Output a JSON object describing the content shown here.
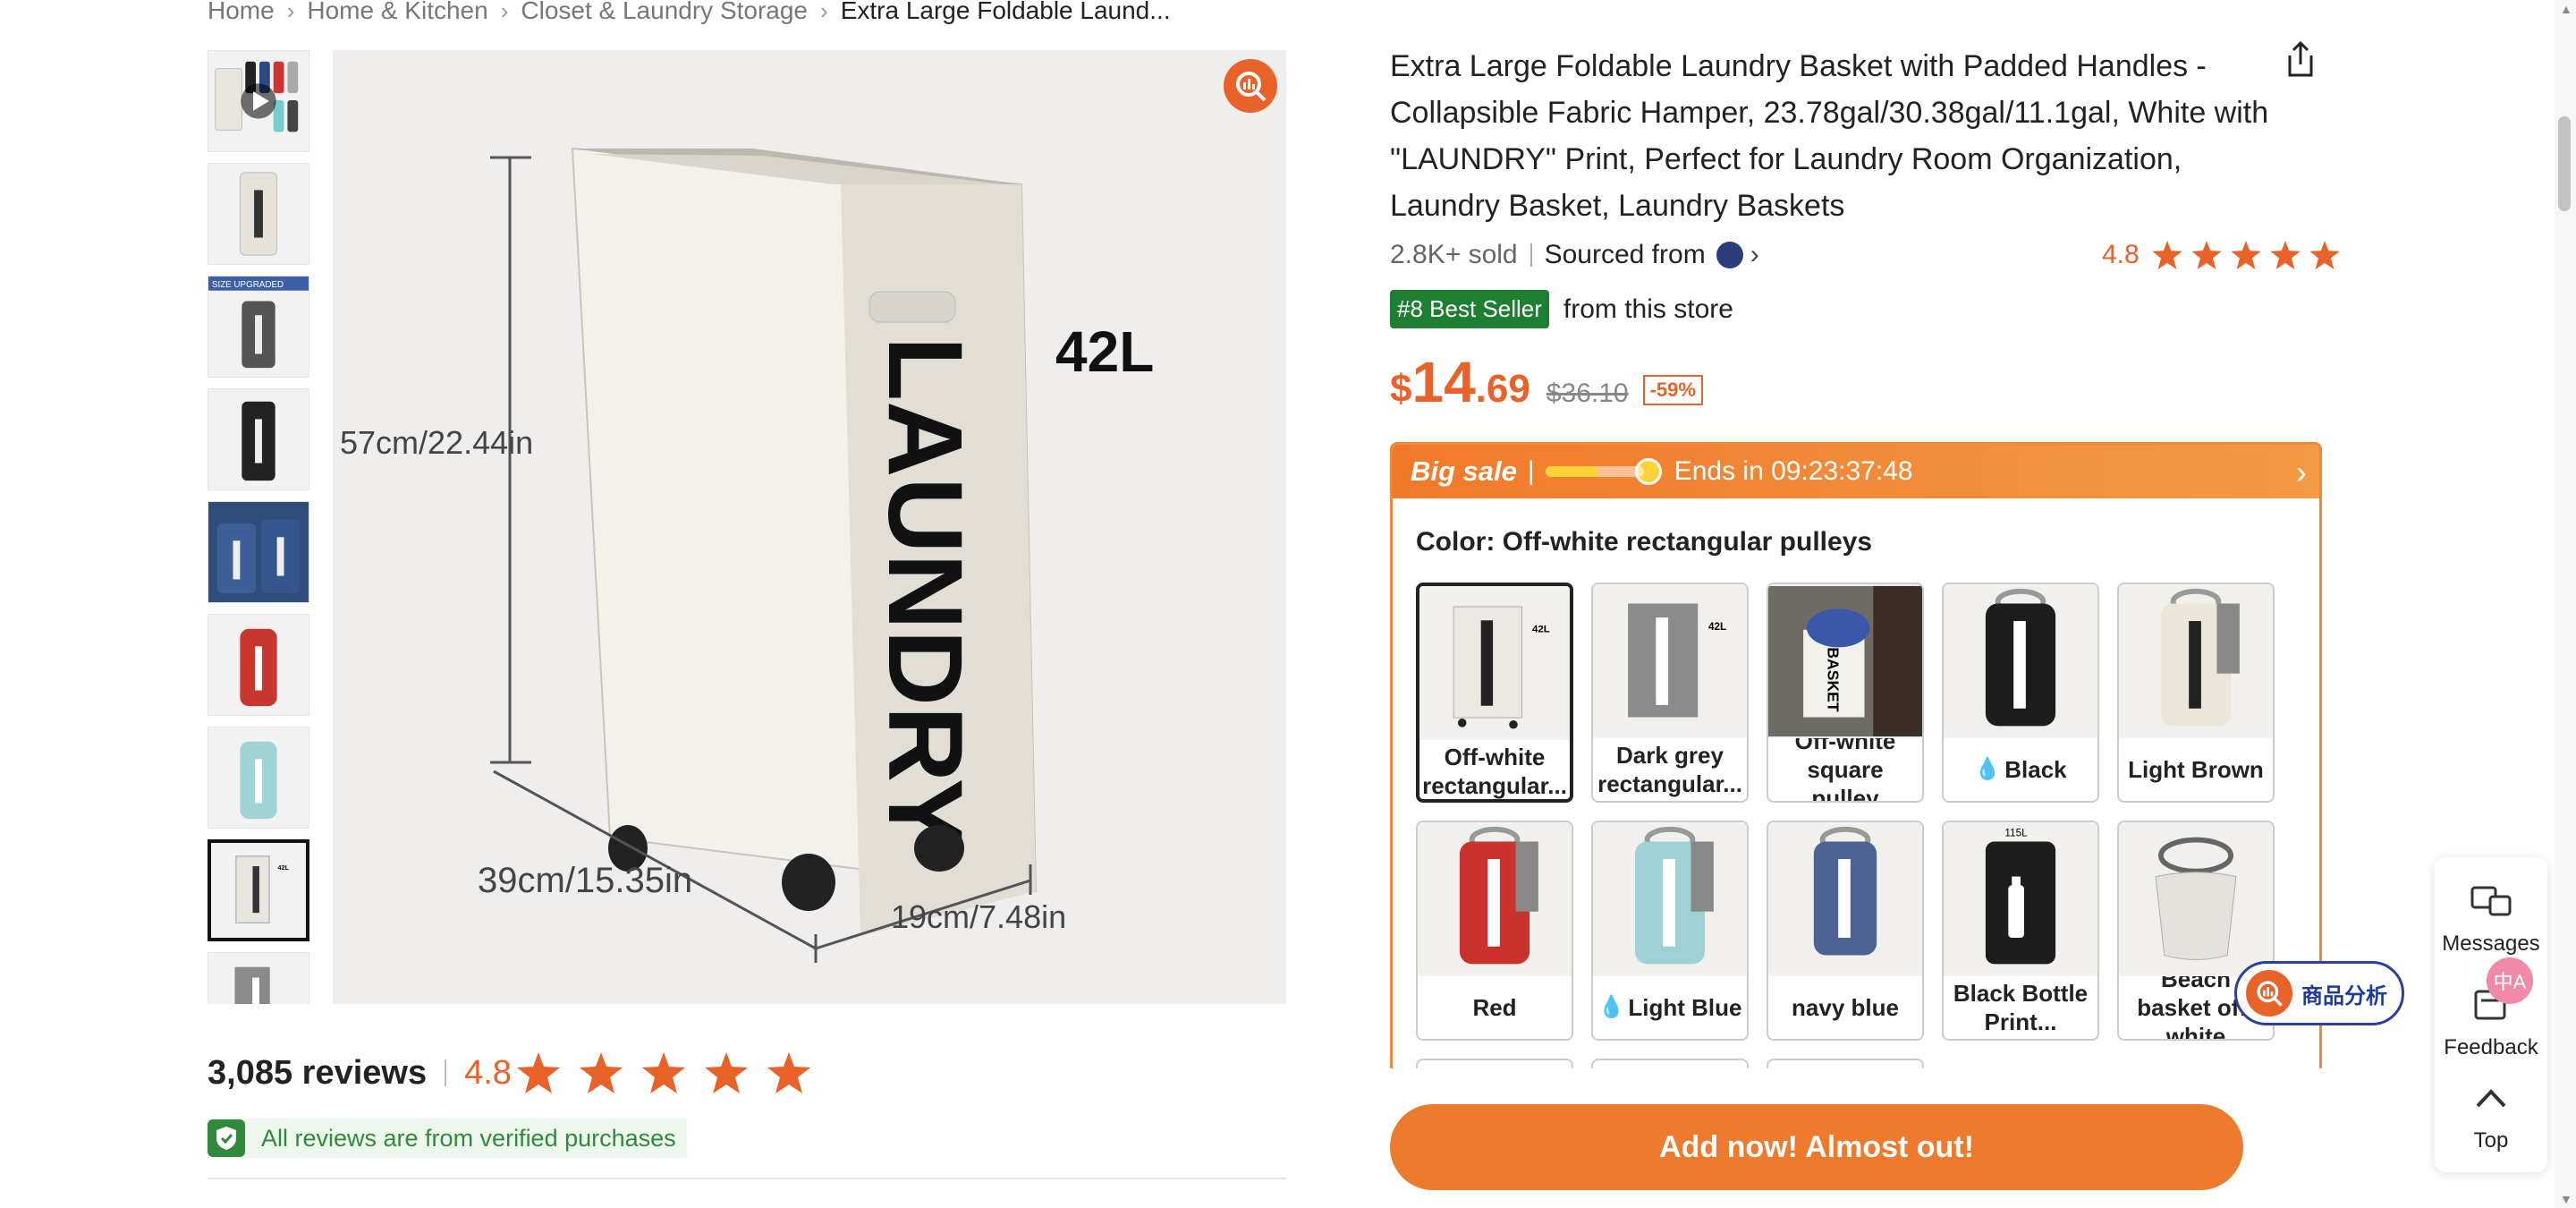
{
  "breadcrumb": {
    "items": [
      "Home",
      "Home & Kitchen",
      "Closet & Laundry Storage"
    ],
    "current": "Extra Large Foldable Laund..."
  },
  "main_image": {
    "capacity_label": "42L",
    "height_label": "57cm/22.44in",
    "length_label": "39cm/15.35in",
    "width_label": "19cm/7.48in",
    "print_text": "LAUNDRY"
  },
  "thumbnail_badge": "SIZE UPGRADED",
  "reviews": {
    "count": "3,085 reviews",
    "rating": "4.8",
    "verified": "All reviews are from verified purchases"
  },
  "product": {
    "title": "Extra Large Foldable Laundry Basket with Padded Handles - Collapsible Fabric Hamper, 23.78gal/30.38gal/11.1gal, White with \"LAUNDRY\" Print, Perfect for Laundry Room Organization, Laundry Basket, Laundry Baskets",
    "sold": "2.8K+ sold",
    "sourced": "Sourced from",
    "rating": "4.8",
    "best_seller_badge": "#8 Best Seller",
    "best_seller_text": "from this store"
  },
  "price": {
    "currency": "$",
    "integer": "14",
    "decimal": ".69",
    "original": "$36.10",
    "discount": "-59%"
  },
  "sale": {
    "title": "Big sale",
    "separator": "|",
    "ends": "Ends in 09:23:37:48",
    "progress": 0.55
  },
  "colors": {
    "label": "Color: Off-white rectangular pulleys",
    "options": [
      {
        "label": "Off-white rectangular...",
        "hot": false
      },
      {
        "label": "Dark grey rectangular...",
        "hot": false
      },
      {
        "label": "Off-white square pulley",
        "hot": false
      },
      {
        "label": "Black",
        "hot": true
      },
      {
        "label": "Light Brown",
        "hot": false
      },
      {
        "label": "Red",
        "hot": false
      },
      {
        "label": "Light Blue",
        "hot": true
      },
      {
        "label": "navy blue",
        "hot": false
      },
      {
        "label": "Black Bottle Print...",
        "hot": false
      },
      {
        "label": "Beach basket off-white",
        "hot": false
      }
    ],
    "swatch_marks": {
      "square": "BASKET",
      "bottle": "115L"
    }
  },
  "cta": {
    "label": "Add now! Almost out!"
  },
  "analysis": {
    "label": "商品分析"
  },
  "side_panel": {
    "messages": "Messages",
    "feedback": "Feedback",
    "top": "Top",
    "translate": "中A"
  },
  "colors_theme": {
    "accent": "#e8622a",
    "best_seller_green": "#1e7f32",
    "verified_green": "#2f8a3b",
    "analysis_blue": "#1e3a9e"
  }
}
